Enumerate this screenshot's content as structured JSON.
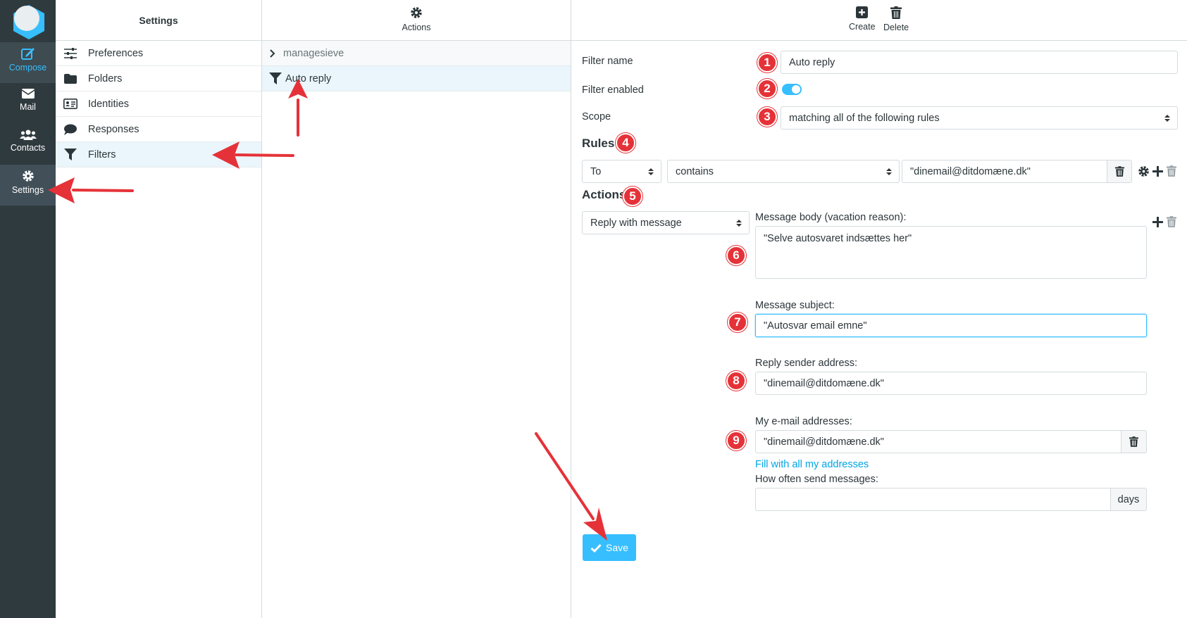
{
  "nav": {
    "items": [
      {
        "label": "Compose",
        "icon": "compose-icon"
      },
      {
        "label": "Mail",
        "icon": "mail-icon"
      },
      {
        "label": "Contacts",
        "icon": "contacts-icon"
      },
      {
        "label": "Settings",
        "icon": "gear-icon"
      }
    ]
  },
  "settings": {
    "title": "Settings",
    "items": [
      {
        "label": "Preferences",
        "icon": "sliders-icon"
      },
      {
        "label": "Folders",
        "icon": "folder-icon"
      },
      {
        "label": "Identities",
        "icon": "id-card-icon"
      },
      {
        "label": "Responses",
        "icon": "comment-icon"
      },
      {
        "label": "Filters",
        "icon": "filter-icon"
      }
    ]
  },
  "filters_list": {
    "actions_label": "Actions",
    "group": "managesieve",
    "selected": "Auto reply"
  },
  "toolbar": {
    "create_label": "Create",
    "delete_label": "Delete"
  },
  "form": {
    "filter_name_label": "Filter name",
    "filter_name_value": "Auto reply",
    "filter_enabled_label": "Filter enabled",
    "filter_enabled": true,
    "scope_label": "Scope",
    "scope_value": "matching all of the following rules",
    "rules_label": "Rules",
    "rule": {
      "header": "To",
      "op": "contains",
      "value": "\"dinemail@ditdomæne.dk\""
    },
    "actions_label": "Actions",
    "action_value": "Reply with message",
    "body_label": "Message body (vacation reason):",
    "body_value": "\"Selve autosvaret indsættes her\"",
    "subject_label": "Message subject:",
    "subject_value": "\"Autosvar email emne\"",
    "sender_label": "Reply sender address:",
    "sender_value": "\"dinemail@ditdomæne.dk\"",
    "addresses_label": "My e-mail addresses:",
    "addresses_value": "\"dinemail@ditdomæne.dk\"",
    "fill_link": "Fill with all my addresses",
    "interval_label": "How often send messages:",
    "interval_value": "",
    "interval_unit": "days",
    "save_label": "Save"
  },
  "annotations": [
    "1",
    "2",
    "3",
    "4",
    "5",
    "6",
    "7",
    "8",
    "9"
  ],
  "colors": {
    "accent": "#37beff",
    "rail": "#2f3a3f",
    "marker": "#e53238"
  }
}
